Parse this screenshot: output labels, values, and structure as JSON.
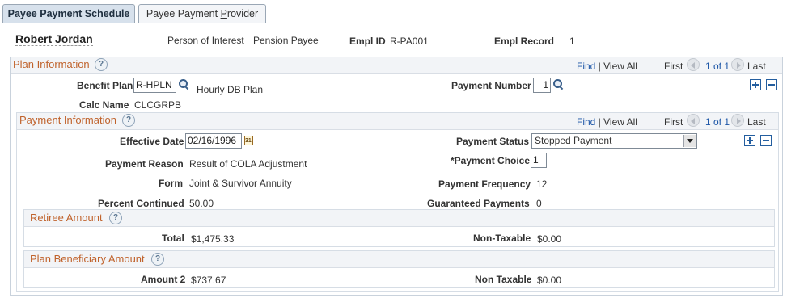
{
  "tabs": [
    {
      "label": "Payee Payment Schedule"
    },
    {
      "label_pre": "Payee Payment ",
      "label_underline": "P",
      "label_post": "rovider"
    }
  ],
  "header": {
    "name": "Robert Jordan",
    "poi_label": "Person of Interest",
    "poi_value": "Pension Payee",
    "emplid_label": "Empl ID",
    "emplid_value": "R-PA001",
    "emplrec_label": "Empl Record",
    "emplrec_value": "1"
  },
  "plan": {
    "title": "Plan Information",
    "find": "Find",
    "sep": " | ",
    "viewall": "View All",
    "first": "First",
    "pager": "1 of 1",
    "last": "Last",
    "benefit_plan_label": "Benefit Plan",
    "benefit_plan_value": "R-HPLN",
    "benefit_plan_desc": "Hourly DB Plan",
    "payment_number_label": "Payment Number",
    "payment_number_value": "1",
    "calc_name_label": "Calc Name",
    "calc_name_value": "CLCGRPB"
  },
  "payment": {
    "title": "Payment Information",
    "find": "Find",
    "sep": " | ",
    "viewall": "View All",
    "first": "First",
    "pager": "1 of 1",
    "last": "Last",
    "effdt_label": "Effective Date",
    "effdt_value": "02/16/1996",
    "status_label": "Payment Status",
    "status_value": "Stopped Payment",
    "reason_label": "Payment Reason",
    "reason_value": "Result of COLA Adjustment",
    "choice_label": "*Payment Choice",
    "choice_value": "1",
    "form_label": "Form",
    "form_value": "Joint & Survivor Annuity",
    "freq_label": "Payment Frequency",
    "freq_value": "12",
    "pct_label": "Percent Continued",
    "pct_value": "50.00",
    "guar_label": "Guaranteed Payments",
    "guar_value": "0"
  },
  "retiree": {
    "title": "Retiree Amount",
    "total_label": "Total",
    "total_value": "$1,475.33",
    "nontax_label": "Non-Taxable",
    "nontax_value": "$0.00"
  },
  "beneficiary": {
    "title": "Plan Beneficiary Amount",
    "amount2_label": "Amount 2",
    "amount2_value": "$737.67",
    "nontax_label": "Non Taxable",
    "nontax_value": "$0.00"
  },
  "help_glyph": "?"
}
